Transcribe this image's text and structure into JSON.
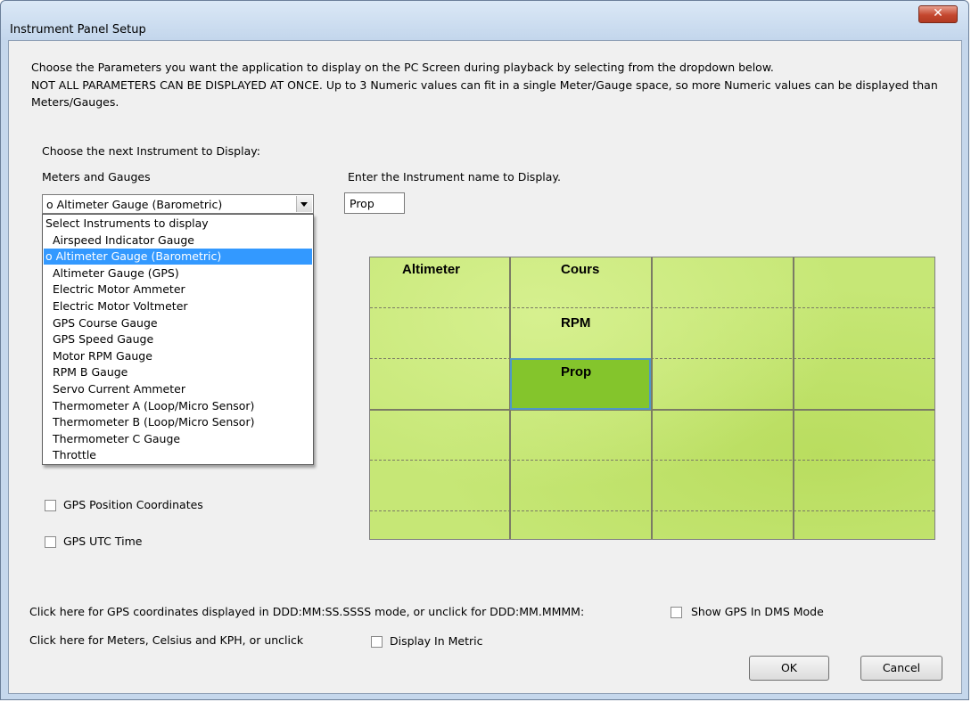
{
  "window": {
    "title": "Instrument Panel Setup",
    "close_glyph": "✕"
  },
  "intro": {
    "line1": "Choose the Parameters  you want the application to display on the PC Screen during playback by selecting from the dropdown below.",
    "line2": "NOT ALL PARAMETERS CAN BE DISPLAYED AT ONCE.  Up to 3 Numeric values can fit in a single Meter/Gauge space, so more Numeric values can be displayed than Meters/Gauges."
  },
  "choose_next_label": "Choose the next Instrument to Display:",
  "meters_label": "Meters and Gauges",
  "instrument_combo": {
    "value": "o Altimeter Gauge (Barometric)"
  },
  "instrument_list": {
    "items": [
      "Select Instruments to display",
      "  Airspeed Indicator Gauge",
      "o Altimeter Gauge (Barometric)",
      "  Altimeter Gauge (GPS)",
      "  Electric Motor Ammeter",
      "  Electric Motor Voltmeter",
      "  GPS Course Gauge",
      "  GPS Speed Gauge",
      "  Motor RPM Gauge",
      "  RPM B Gauge",
      "  Servo Current Ammeter",
      "  Thermometer A (Loop/Micro Sensor)",
      "  Thermometer B (Loop/Micro Sensor)",
      "  Thermometer C Gauge",
      "  Throttle"
    ],
    "selected_index": 2
  },
  "name_label": "Enter the Instrument name to Display.",
  "name_input": {
    "value": "Prop"
  },
  "panel": {
    "cells": [
      "Altimeter",
      "Cours",
      "RPM",
      "Prop"
    ]
  },
  "checkboxes": {
    "gps_position": {
      "label": "GPS Position Coordinates",
      "checked": false
    },
    "gps_utc": {
      "label": "GPS UTC Time",
      "checked": false
    },
    "dms_mode": {
      "label": "Show GPS In DMS Mode",
      "checked": false
    },
    "metric": {
      "label": "Display In Metric",
      "checked": false
    }
  },
  "dms_prompt": "Click here for GPS coordinates displayed in DDD:MM:SS.SSSS mode, or unclick for DDD:MM.MMMM:",
  "metric_prompt": "Click here for Meters, Celsius and KPH, or unclick",
  "buttons": {
    "ok": "OK",
    "cancel": "Cancel"
  }
}
